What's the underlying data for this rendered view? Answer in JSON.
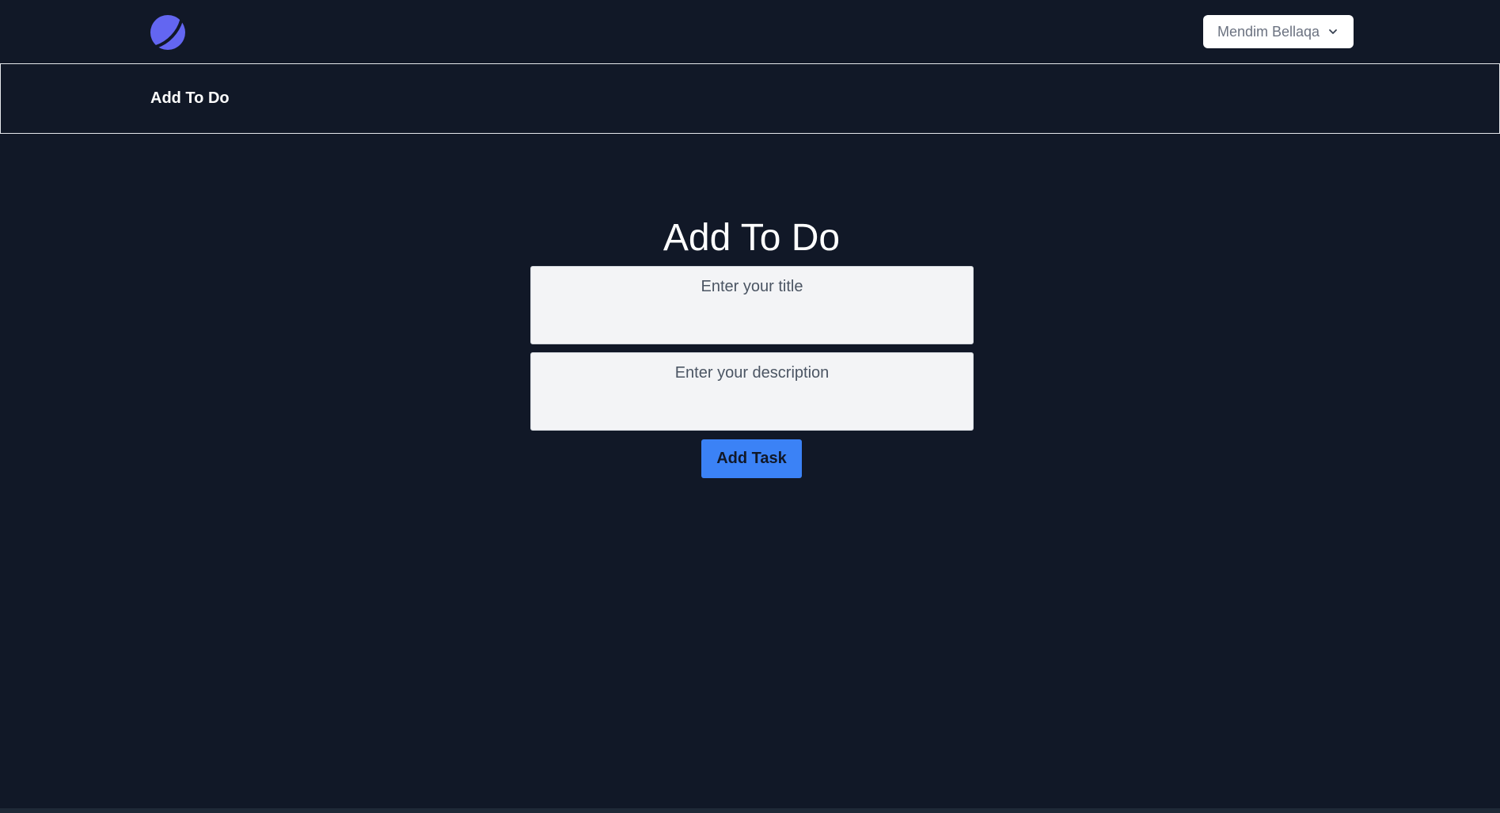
{
  "header": {
    "logo_icon": "planet-logo-icon",
    "user_menu": {
      "name": "Mendim Bellaqa",
      "icon": "chevron-down-icon"
    }
  },
  "subheader": {
    "title": "Add To Do"
  },
  "form": {
    "heading": "Add To Do",
    "title_field": {
      "placeholder": "Enter your title",
      "value": ""
    },
    "description_field": {
      "placeholder": "Enter your description",
      "value": ""
    },
    "submit_label": "Add Task"
  },
  "colors": {
    "background": "#111827",
    "accent": "#3b82f6",
    "logo": "#6366f1"
  }
}
